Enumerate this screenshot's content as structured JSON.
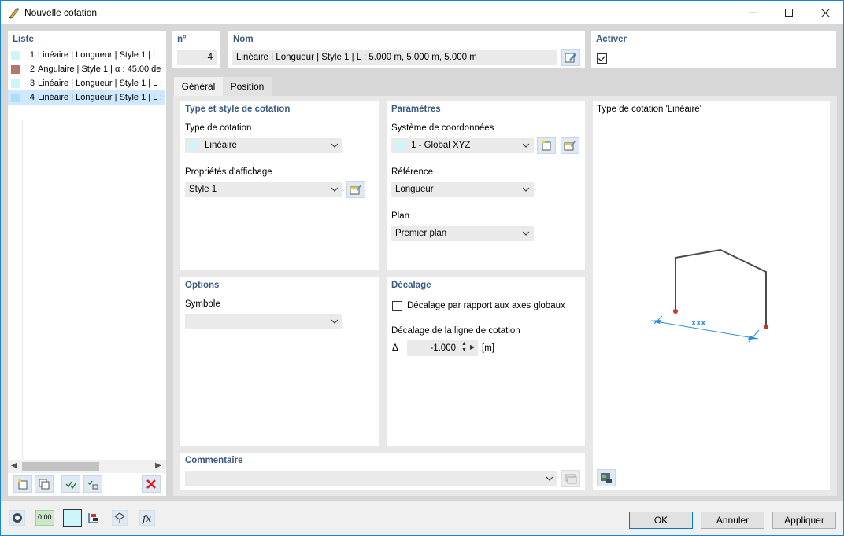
{
  "window": {
    "title": "Nouvelle cotation",
    "minimize": "—",
    "maximize": "☐",
    "close": "✕"
  },
  "list": {
    "header": "Liste",
    "items": [
      {
        "num": "1",
        "label": "Linéaire | Longueur | Style 1 | L :",
        "color": "#cdf6fb"
      },
      {
        "num": "2",
        "label": "Angulaire | Style 1 | α : 45.00 de",
        "color": "#b8736a"
      },
      {
        "num": "3",
        "label": "Linéaire | Longueur | Style 1 | L :",
        "color": "#cdf6fb"
      },
      {
        "num": "4",
        "label": "Linéaire | Longueur | Style 1 | L :",
        "color": "#a9dff6"
      }
    ],
    "selected_index": 3
  },
  "number": {
    "header": "n°",
    "value": "4"
  },
  "name": {
    "header": "Nom",
    "value": "Linéaire | Longueur | Style 1 | L : 5.000 m, 5.000 m, 5.000 m"
  },
  "activate": {
    "header": "Activer",
    "checked": true
  },
  "tabs": [
    {
      "label": "Général",
      "active": true
    },
    {
      "label": "Position",
      "active": false
    }
  ],
  "type_style": {
    "header": "Type et style de cotation",
    "type_label": "Type de cotation",
    "type_value": "Linéaire",
    "type_color": "#cdf6fb",
    "display_label": "Propriétés d'affichage",
    "display_value": "Style 1"
  },
  "parameters": {
    "header": "Paramètres",
    "coord_label": "Système de coordonnées",
    "coord_value": "1 - Global XYZ",
    "coord_color": "#cdf6fb",
    "reference_label": "Référence",
    "reference_value": "Longueur",
    "plane_label": "Plan",
    "plane_value": "Premier plan"
  },
  "options": {
    "header": "Options",
    "symbol_label": "Symbole",
    "symbol_value": ""
  },
  "offset": {
    "header": "Décalage",
    "global_axes_label": "Décalage par rapport aux axes globaux",
    "global_axes_checked": false,
    "line_offset_label": "Décalage de la ligne de cotation",
    "delta_symbol": "Δ",
    "line_offset_value": "-1.000",
    "unit": "[m]"
  },
  "preview": {
    "title": "Type de cotation 'Linéaire'",
    "dimension_text": "xxx"
  },
  "comment": {
    "header": "Commentaire",
    "value": ""
  },
  "footer": {
    "ok": "OK",
    "cancel": "Annuler",
    "apply": "Appliquer",
    "number_icon_text": "0,00"
  },
  "colors": {
    "accent": "#1883d7",
    "header_text": "#3a5a80",
    "selection": "#cde8ff",
    "node_red": "#c0392b",
    "dimension_blue": "#2a8fd6"
  }
}
